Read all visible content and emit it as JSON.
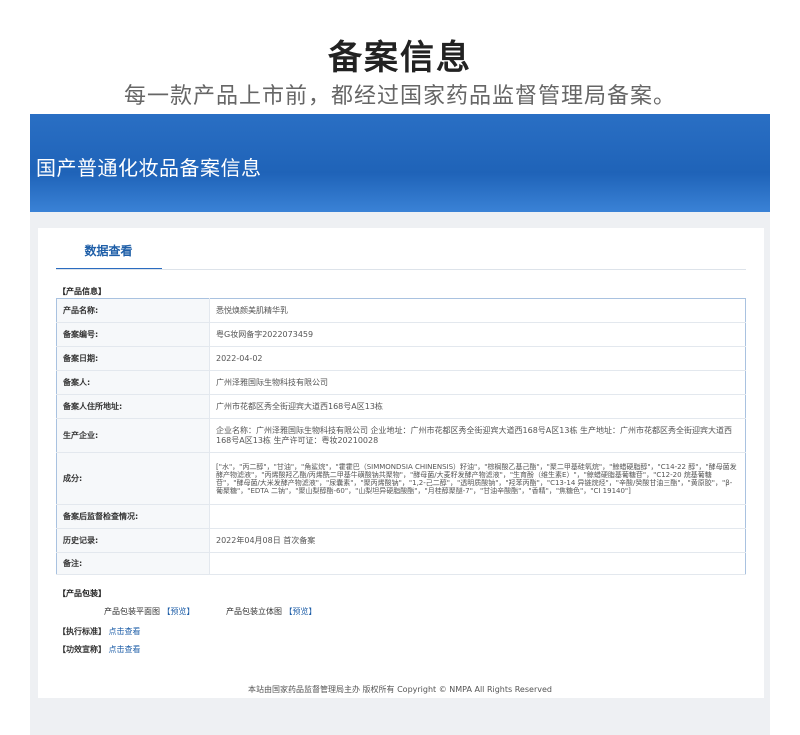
{
  "header": {
    "title": "备案信息",
    "subtitle": "每一款产品上市前，都经过国家药品监督管理局备案。"
  },
  "banner": {
    "title": "国产普通化妆品备案信息"
  },
  "tabs": [
    {
      "label": "数据查看",
      "active": true
    }
  ],
  "product_info": {
    "section_label": "【产品信息】",
    "rows": [
      {
        "key": "产品名称:",
        "value": "悉悦焕颜美肌精华乳"
      },
      {
        "key": "备案编号:",
        "value": "粤G妆网备字2022073459"
      },
      {
        "key": "备案日期:",
        "value": "2022-04-02"
      },
      {
        "key": "备案人:",
        "value": "广州泽雅国际生物科技有限公司"
      },
      {
        "key": "备案人住所地址:",
        "value": "广州市花都区秀全街迎宾大道西168号A区13栋"
      },
      {
        "key": "生产企业:",
        "value": "企业名称：广州泽雅国际生物科技有限公司 企业地址：广州市花都区秀全街迎宾大道西168号A区13栋 生产地址：广州市花都区秀全街迎宾大道西168号A区13栋 生产许可证：粤妆20210028"
      },
      {
        "key": "成分:",
        "value": "[\"水\"，\"丙二醇\"，\"甘油\"，\"角鲨烷\"，\"霍霍巴（SIMMONDSIA CHINENSIS）籽油\"，\"棕榈酸乙基己酯\"，\"聚二甲基硅氧烷\"，\"鲸蜡硬脂醇\"，\"C14-22 醇\"，\"酵母菌发酵产物滤液\"，\"丙烯酸羟乙酯/丙烯酰二甲基牛磺酸钠共聚物\"，\"酵母菌/大麦籽发酵产物滤液\"，\"生育酚（维生素E）\"，\"鲸蜡硬脂基葡糖苷\"，\"C12-20 烷基葡糖苷\"，\"酵母菌/大米发酵产物滤液\"，\"尿囊素\"，\"聚丙烯酸钠\"，\"1,2-己二醇\"，\"透明质酸钠\"，\"羟苯丙酯\"，\"C13-14 异链烷烃\"，\"辛酸/癸酸甘油三酯\"，\"黄原胶\"，\"β-葡聚糖\"，\"EDTA 二钠\"，\"聚山梨醇酯-60\"，\"山梨坦异硬脂酸酯\"，\"月桂醇聚醚-7\"，\"甘油辛酸酯\"，\"香精\"，\"焦糖色\"，\"CI 19140\"]"
      },
      {
        "key": "备案后监督检查情况:",
        "value": ""
      },
      {
        "key": "历史记录:",
        "value": "2022年04月08日  首次备案"
      },
      {
        "key": "备注:",
        "value": ""
      }
    ]
  },
  "packaging": {
    "section_label": "【产品包装】",
    "flat_label": "产品包装平面图",
    "flat_link": "【预览】",
    "solid_label": "产品包装立体图",
    "solid_link": "【预览】"
  },
  "standard": {
    "label": "【执行标准】",
    "link": "点击查看"
  },
  "efficacy": {
    "label": "【功效宣称】",
    "link": "点击查看"
  },
  "footer": {
    "text": "本站由国家药品监督管理局主办 版权所有 Copyright © NMPA All Rights Reserved"
  },
  "colors": {
    "accent": "#1f5fa8",
    "banner": "#2a6fc4",
    "table_border": "#a9c2e0"
  }
}
